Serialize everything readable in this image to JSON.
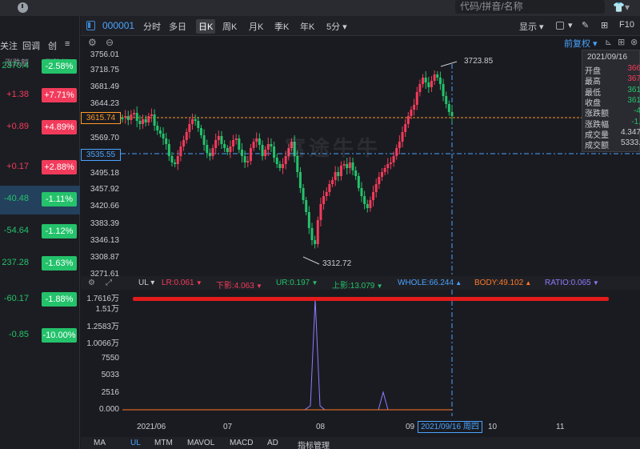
{
  "search": {
    "placeholder": "代码/拼音/名称"
  },
  "left_tabs": [
    "关注",
    "回调",
    "创"
  ],
  "left_headers": {
    "amount": "涨跌额",
    "percent": "涨跌幅"
  },
  "left_rows": [
    {
      "amount": "2370.4",
      "percent": "-2.58%",
      "dir": "down"
    },
    {
      "amount": "+1.38",
      "percent": "+7.71%",
      "dir": "up"
    },
    {
      "amount": "+0.89",
      "percent": "+4.89%",
      "dir": "up"
    },
    {
      "amount": "+0.17",
      "percent": "+2.88%",
      "dir": "up"
    },
    {
      "amount": "-40.48",
      "percent": "-1.11%",
      "dir": "down"
    },
    {
      "amount": "-54.64",
      "percent": "-1.12%",
      "dir": "down"
    },
    {
      "amount": "237.28",
      "percent": "-1.63%",
      "dir": "down"
    },
    {
      "amount": "-60.17",
      "percent": "-1.88%",
      "dir": "down"
    },
    {
      "amount": "-0.85",
      "percent": "-10.00%",
      "dir": "down"
    }
  ],
  "toolbar": {
    "code": "000001",
    "periods": [
      "分时",
      "多日",
      "日K",
      "周K",
      "月K",
      "季K",
      "年K",
      "5分"
    ],
    "active_period": "日K",
    "display": "显示",
    "f10": "F10"
  },
  "chart": {
    "fuquan": "前复权",
    "price_ticks": [
      "3756.01",
      "3718.75",
      "3681.49",
      "3644.23",
      "3569.70",
      "3495.18",
      "3457.92",
      "3420.66",
      "3383.39",
      "3346.13",
      "3308.87",
      "3271.61"
    ],
    "tag_orange": "3615.74",
    "tag_blue": "3535.55",
    "high_ann": "3723.85",
    "low_ann": "3312.72",
    "watermark": "富途牛牛"
  },
  "info_panel": {
    "date": "2021/09/16",
    "rows": [
      {
        "k": "开盘",
        "v": "366",
        "c": "#f23b5b"
      },
      {
        "k": "最高",
        "v": "367",
        "c": "#f23b5b"
      },
      {
        "k": "最低",
        "v": "361",
        "c": "#24c26b"
      },
      {
        "k": "收盘",
        "v": "361",
        "c": "#24c26b"
      },
      {
        "k": "涨跌额",
        "v": "-4",
        "c": "#24c26b"
      },
      {
        "k": "涨跌幅",
        "v": "-1.",
        "c": "#24c26b"
      },
      {
        "k": "成交量",
        "v": "4.347",
        "c": "#c9cdd4"
      },
      {
        "k": "成交额",
        "v": "5333.",
        "c": "#c9cdd4"
      }
    ]
  },
  "indicators": {
    "name": "UL",
    "items": [
      {
        "text": "LR:0.061",
        "color": "#f23b5b",
        "arrow": "▼"
      },
      {
        "text": "下影:4.063",
        "color": "#f23b5b",
        "arrow": "▼"
      },
      {
        "text": "UR:0.197",
        "color": "#24c26b",
        "arrow": "▼"
      },
      {
        "text": "上影:13.079",
        "color": "#24c26b",
        "arrow": "▼"
      },
      {
        "text": "WHOLE:66.244",
        "color": "#4aa3ff",
        "arrow": "▲"
      },
      {
        "text": "BODY:49.102",
        "color": "#ff7a2a",
        "arrow": "▲"
      },
      {
        "text": "RATIO:0.065",
        "color": "#8c7cff",
        "arrow": "▼"
      }
    ]
  },
  "volume_ticks": [
    "1.7616万",
    "1.51万",
    "1.2583万",
    "1.0066万",
    "7550",
    "5033",
    "2516",
    "0.000"
  ],
  "x_ticks": [
    "2021/06",
    "07",
    "08",
    "09",
    "10",
    "11"
  ],
  "crosshair_date": "2021/09/16 周四",
  "bottom_tabs": [
    "MA",
    "UL",
    "MTM",
    "MAVOL",
    "MACD",
    "AD",
    "指标管理"
  ],
  "active_bottom_tab": "UL",
  "colors": {
    "up": "#f23b5b",
    "down": "#24c26b",
    "accent": "#4aa3ff"
  }
}
